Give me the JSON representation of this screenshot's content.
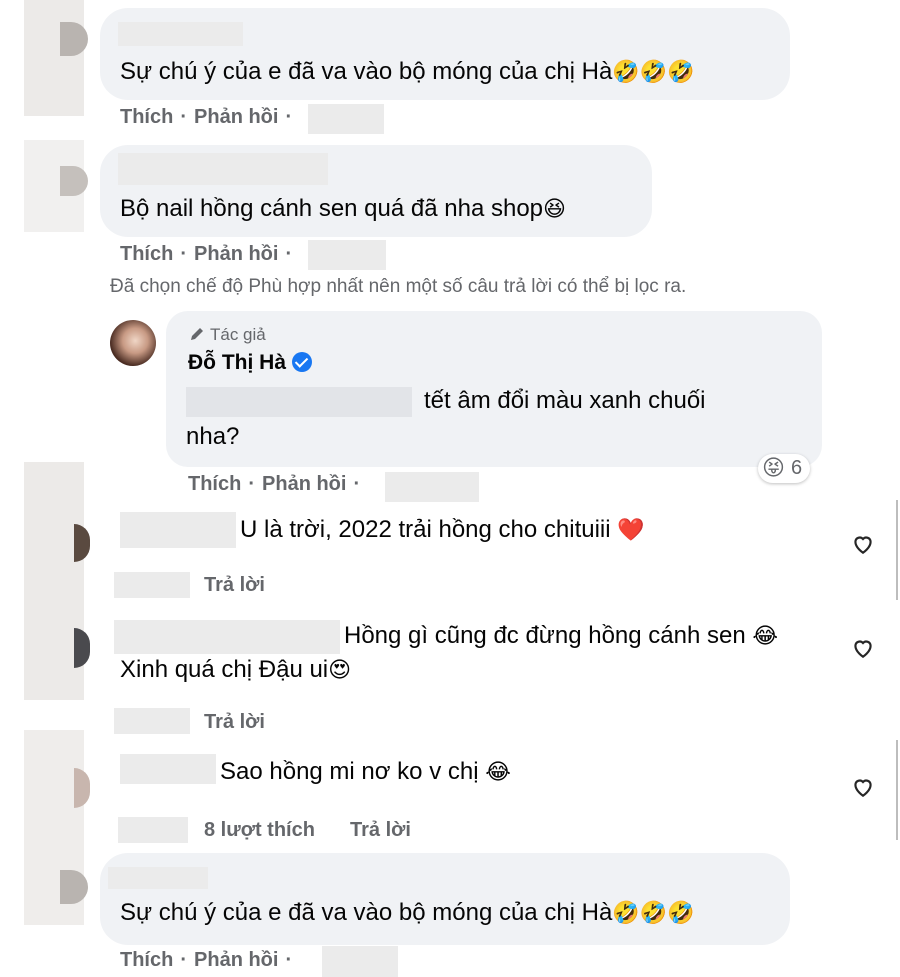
{
  "comments": [
    {
      "text": "Sự chú ý của e đã va vào bộ móng của chị Hà",
      "emoji": "🤣🤣🤣"
    },
    {
      "text": "Bộ nail hồng cánh sen quá đã nha shop",
      "emoji": "😆"
    }
  ],
  "actions": {
    "like": "Thích",
    "reply": "Phản hồi",
    "separator": "·"
  },
  "filter_note": "Đã chọn chế độ Phù hợp nhất nên một số câu trả lời có thể bị lọc ra.",
  "author_reply": {
    "badge": "Tác giả",
    "name": "Đỗ Thị Hà",
    "text_line1": "tết âm đổi màu xanh chuối",
    "text_line2": "nha?",
    "reaction_emoji": "😝",
    "reaction_count": "6"
  },
  "ig_comments": [
    {
      "text": "U là trời, 2022 trải hồng cho chituiii",
      "emoji": "❤️",
      "reply": "Trả lời"
    },
    {
      "text_line1": "Hồng gì cũng đc đừng hồng cánh sen",
      "emoji1": "😂",
      "text_line2": "Xinh quá chị Đậu ui",
      "emoji2": "😍",
      "reply": "Trả lời"
    },
    {
      "text": "Sao hồng mi nơ ko v chị",
      "emoji": "😂",
      "likes": "8 lượt thích",
      "reply": "Trả lời"
    }
  ],
  "bottom_comment": {
    "text": "Sự chú ý của e đã va vào bộ móng của chị Hà",
    "emoji": "🤣🤣🤣"
  },
  "colors": {
    "bubble": "#f0f2f5",
    "meta": "#65676b",
    "verified": "#1877f2",
    "heart": "#262626"
  }
}
